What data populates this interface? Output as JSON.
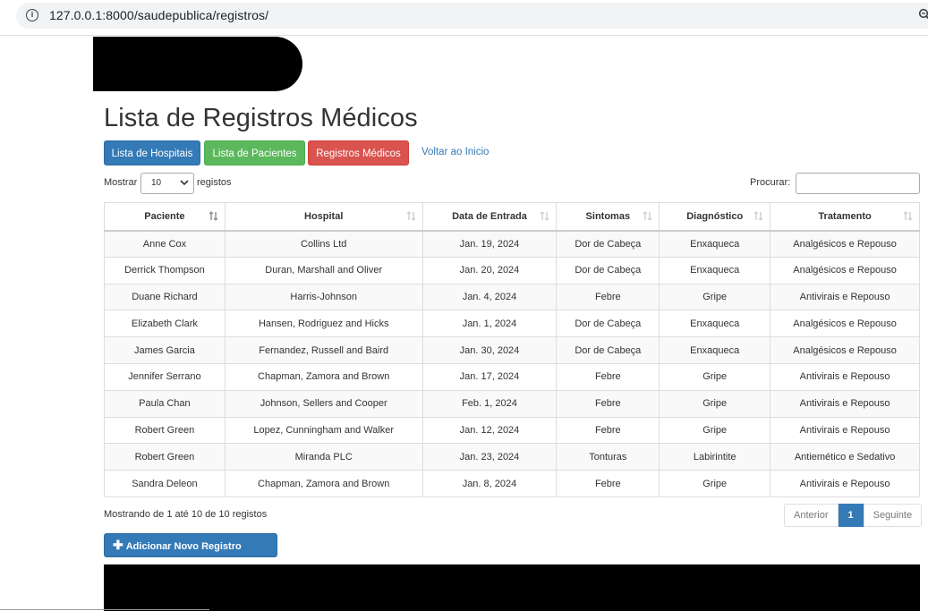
{
  "browser": {
    "url": "127.0.0.1:8000/saudepublica/registros/"
  },
  "page": {
    "title": "Lista de Registros Médicos",
    "nav": {
      "hospitais": "Lista de Hospitais",
      "pacientes": "Lista de Pacientes",
      "registros": "Registros Médicos",
      "voltar": "Voltar ao Inicio"
    },
    "controls": {
      "mostrar": "Mostrar",
      "registos": "registos",
      "length_value": "10",
      "procurar": "Procurar:"
    },
    "table": {
      "headers": [
        "Paciente",
        "Hospital",
        "Data de Entrada",
        "Sintomas",
        "Diagnóstico",
        "Tratamento"
      ],
      "rows": [
        [
          "Anne Cox",
          "Collins Ltd",
          "Jan. 19, 2024",
          "Dor de Cabeça",
          "Enxaqueca",
          "Analgésicos e Repouso"
        ],
        [
          "Derrick Thompson",
          "Duran, Marshall and Oliver",
          "Jan. 20, 2024",
          "Dor de Cabeça",
          "Enxaqueca",
          "Analgésicos e Repouso"
        ],
        [
          "Duane Richard",
          "Harris-Johnson",
          "Jan. 4, 2024",
          "Febre",
          "Gripe",
          "Antivirais e Repouso"
        ],
        [
          "Elizabeth Clark",
          "Hansen, Rodriguez and Hicks",
          "Jan. 1, 2024",
          "Dor de Cabeça",
          "Enxaqueca",
          "Analgésicos e Repouso"
        ],
        [
          "James Garcia",
          "Fernandez, Russell and Baird",
          "Jan. 30, 2024",
          "Dor de Cabeça",
          "Enxaqueca",
          "Analgésicos e Repouso"
        ],
        [
          "Jennifer Serrano",
          "Chapman, Zamora and Brown",
          "Jan. 17, 2024",
          "Febre",
          "Gripe",
          "Antivirais e Repouso"
        ],
        [
          "Paula Chan",
          "Johnson, Sellers and Cooper",
          "Feb. 1, 2024",
          "Febre",
          "Gripe",
          "Antivirais e Repouso"
        ],
        [
          "Robert Green",
          "Lopez, Cunningham and Walker",
          "Jan. 12, 2024",
          "Febre",
          "Gripe",
          "Antivirais e Repouso"
        ],
        [
          "Robert Green",
          "Miranda PLC",
          "Jan. 23, 2024",
          "Tonturas",
          "Labirintite",
          "Antiemético e Sedativo"
        ],
        [
          "Sandra Deleon",
          "Chapman, Zamora and Brown",
          "Jan. 8, 2024",
          "Febre",
          "Gripe",
          "Antivirais e Repouso"
        ]
      ]
    },
    "footer": {
      "info": "Mostrando de 1 até 10 de 10 registos",
      "anterior": "Anterior",
      "current_page": "1",
      "seguinte": "Seguinte",
      "add_button": "Adicionar Novo Registro Médico"
    }
  },
  "colors": {
    "primary": "#337ab7",
    "success": "#5cb85c",
    "danger": "#d9534f"
  },
  "icons": [
    "info-icon",
    "zoom-icon",
    "sort-icon",
    "chevron-down-icon",
    "plus-icon"
  ]
}
